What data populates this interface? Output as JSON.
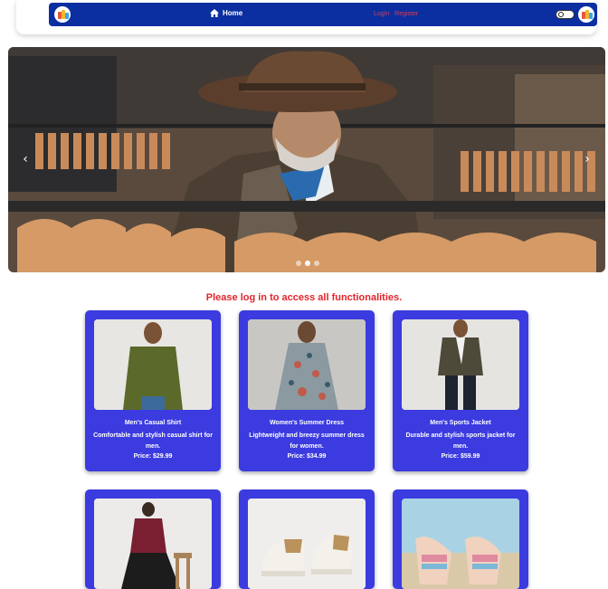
{
  "nav": {
    "home_label": "Home",
    "login_label": "Login",
    "register_label": "Register"
  },
  "carousel": {
    "prev_glyph": "‹",
    "next_glyph": "›",
    "slide_count": 3,
    "active_slide": 2
  },
  "notice": "Please log in to access all functionalities.",
  "products": [
    {
      "name": "Men's Casual Shirt",
      "description": "Comfortable and stylish casual shirt for men.",
      "price": "Price: $29.99"
    },
    {
      "name": "Women's Summer Dress",
      "description": "Lightweight and breezy summer dress for women.",
      "price": "Price: $34.99"
    },
    {
      "name": "Men's Sports Jacket",
      "description": "Durable and stylish sports jacket for men.",
      "price": "Price: $59.99"
    },
    {
      "name": "",
      "description": "",
      "price": ""
    },
    {
      "name": "",
      "description": "",
      "price": ""
    },
    {
      "name": "",
      "description": "",
      "price": ""
    }
  ],
  "colors": {
    "navbar": "#0b2fa0",
    "card": "#3b3be0",
    "notice": "#e3242b",
    "auth_links": "#e23b4f"
  }
}
